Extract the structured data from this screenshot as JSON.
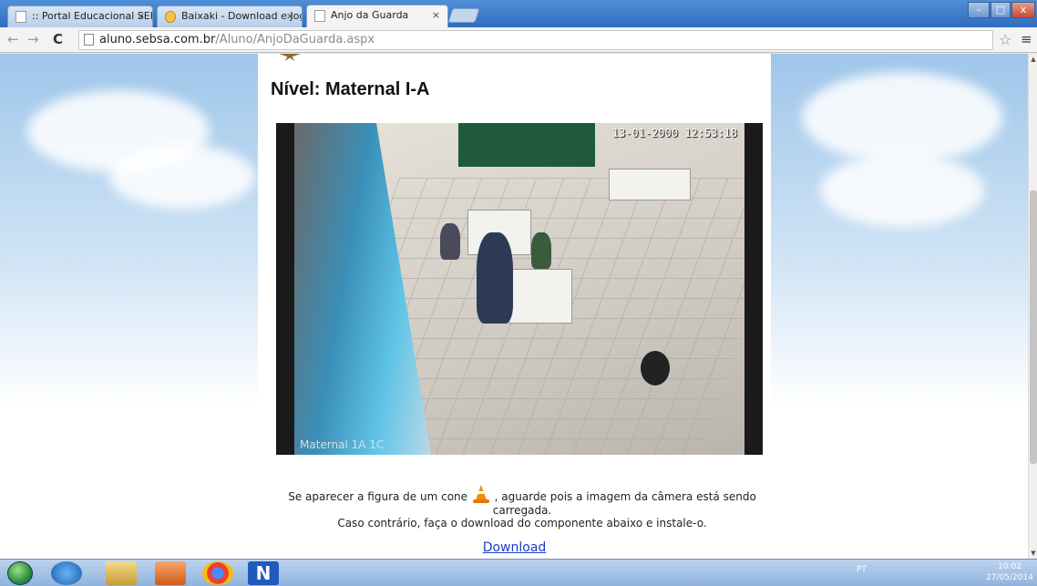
{
  "browser": {
    "tabs": [
      {
        "label": ":: Portal Educacional SEB",
        "close": "×"
      },
      {
        "label": "Baixaki - Download e Jogo",
        "close": "×"
      },
      {
        "label": "Anjo da Guarda",
        "close": "×"
      }
    ],
    "window_buttons": {
      "minimize": "–",
      "maximize": "□",
      "close": "x"
    },
    "address": {
      "host": "aluno.sebsa.com.br",
      "path": "/Aluno/AnjoDaGuarda.aspx"
    },
    "nav": {
      "back": "←",
      "forward": "→",
      "reload": "C"
    },
    "star": "☆",
    "menu": "≡"
  },
  "page": {
    "level_title": "Nível: Maternal I-A",
    "camera": {
      "timestamp": "13-01-2000 12:53:18",
      "label": "Maternal 1A 1C"
    },
    "notice": {
      "line1_before": "Se aparecer a figura de um cone ",
      "line1_after": " , aguarde pois a imagem da câmera está sendo",
      "line2": "carregada.",
      "line3": "Caso contrário, faça o download do componente abaixo e instale-o."
    },
    "download_label": "Download"
  },
  "taskbar": {
    "tray_text": "PT",
    "time": "10:02",
    "date": "27/05/2014"
  },
  "colors": {
    "link": "#1a3cc8",
    "titlebar": "#2f6cc0",
    "cone": "#f28b0c"
  }
}
